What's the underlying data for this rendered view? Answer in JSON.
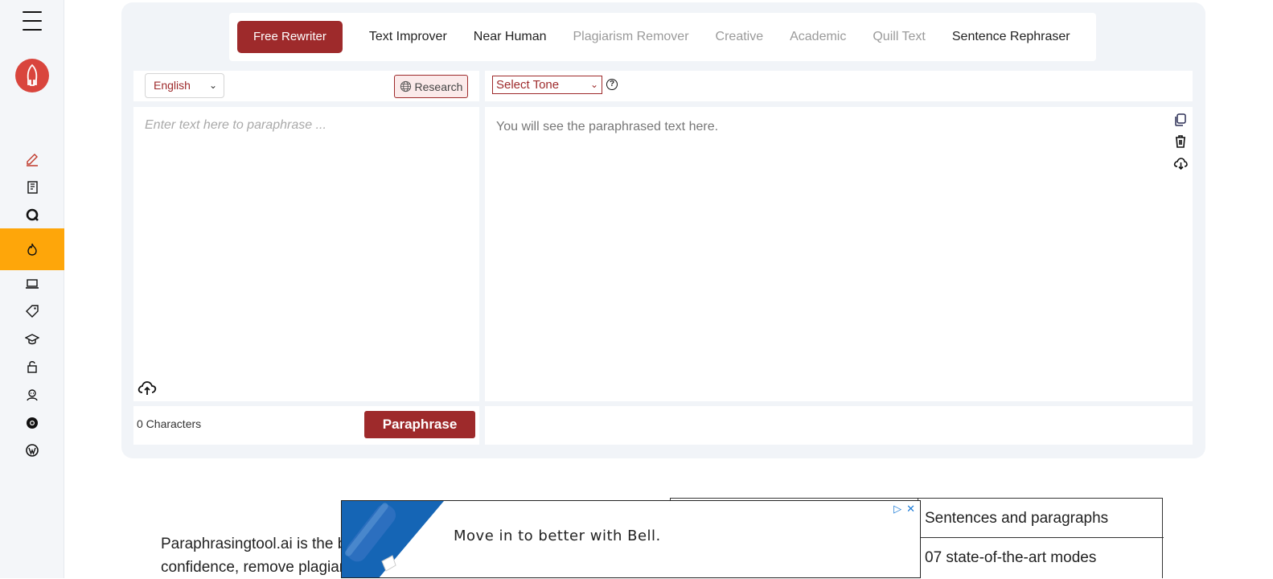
{
  "tabs": [
    {
      "label": "Free Rewriter",
      "state": "active"
    },
    {
      "label": "Text Improver",
      "state": "normal"
    },
    {
      "label": "Near Human",
      "state": "normal"
    },
    {
      "label": "Plagiarism Remover",
      "state": "muted"
    },
    {
      "label": "Creative",
      "state": "muted"
    },
    {
      "label": "Academic",
      "state": "muted"
    },
    {
      "label": "Quill Text",
      "state": "muted"
    },
    {
      "label": "Sentence Rephraser",
      "state": "normal"
    }
  ],
  "input": {
    "language": "English",
    "research_label": "Research",
    "placeholder": "Enter text here to paraphrase ...",
    "char_count": "0 Characters",
    "paraphrase_label": "Paraphrase"
  },
  "output": {
    "tone_label": "Select Tone",
    "help_symbol": "?",
    "placeholder": "You will see the paraphrased text here."
  },
  "content": {
    "para_line1": "Paraphrasingtool.ai is the be",
    "para_line2": "confidence, remove plagiar",
    "table_row1": "Sentences and paragraphs",
    "table_row2": "07 state-of-the-art modes"
  },
  "ad": {
    "text": "Move in to better with Bell.",
    "info_icon": "ad-choices-icon",
    "close_symbol": "✕"
  },
  "colors": {
    "brand": "#9e2a2b",
    "active_sidebar": "#fea60a",
    "logo": "#d9453d"
  }
}
